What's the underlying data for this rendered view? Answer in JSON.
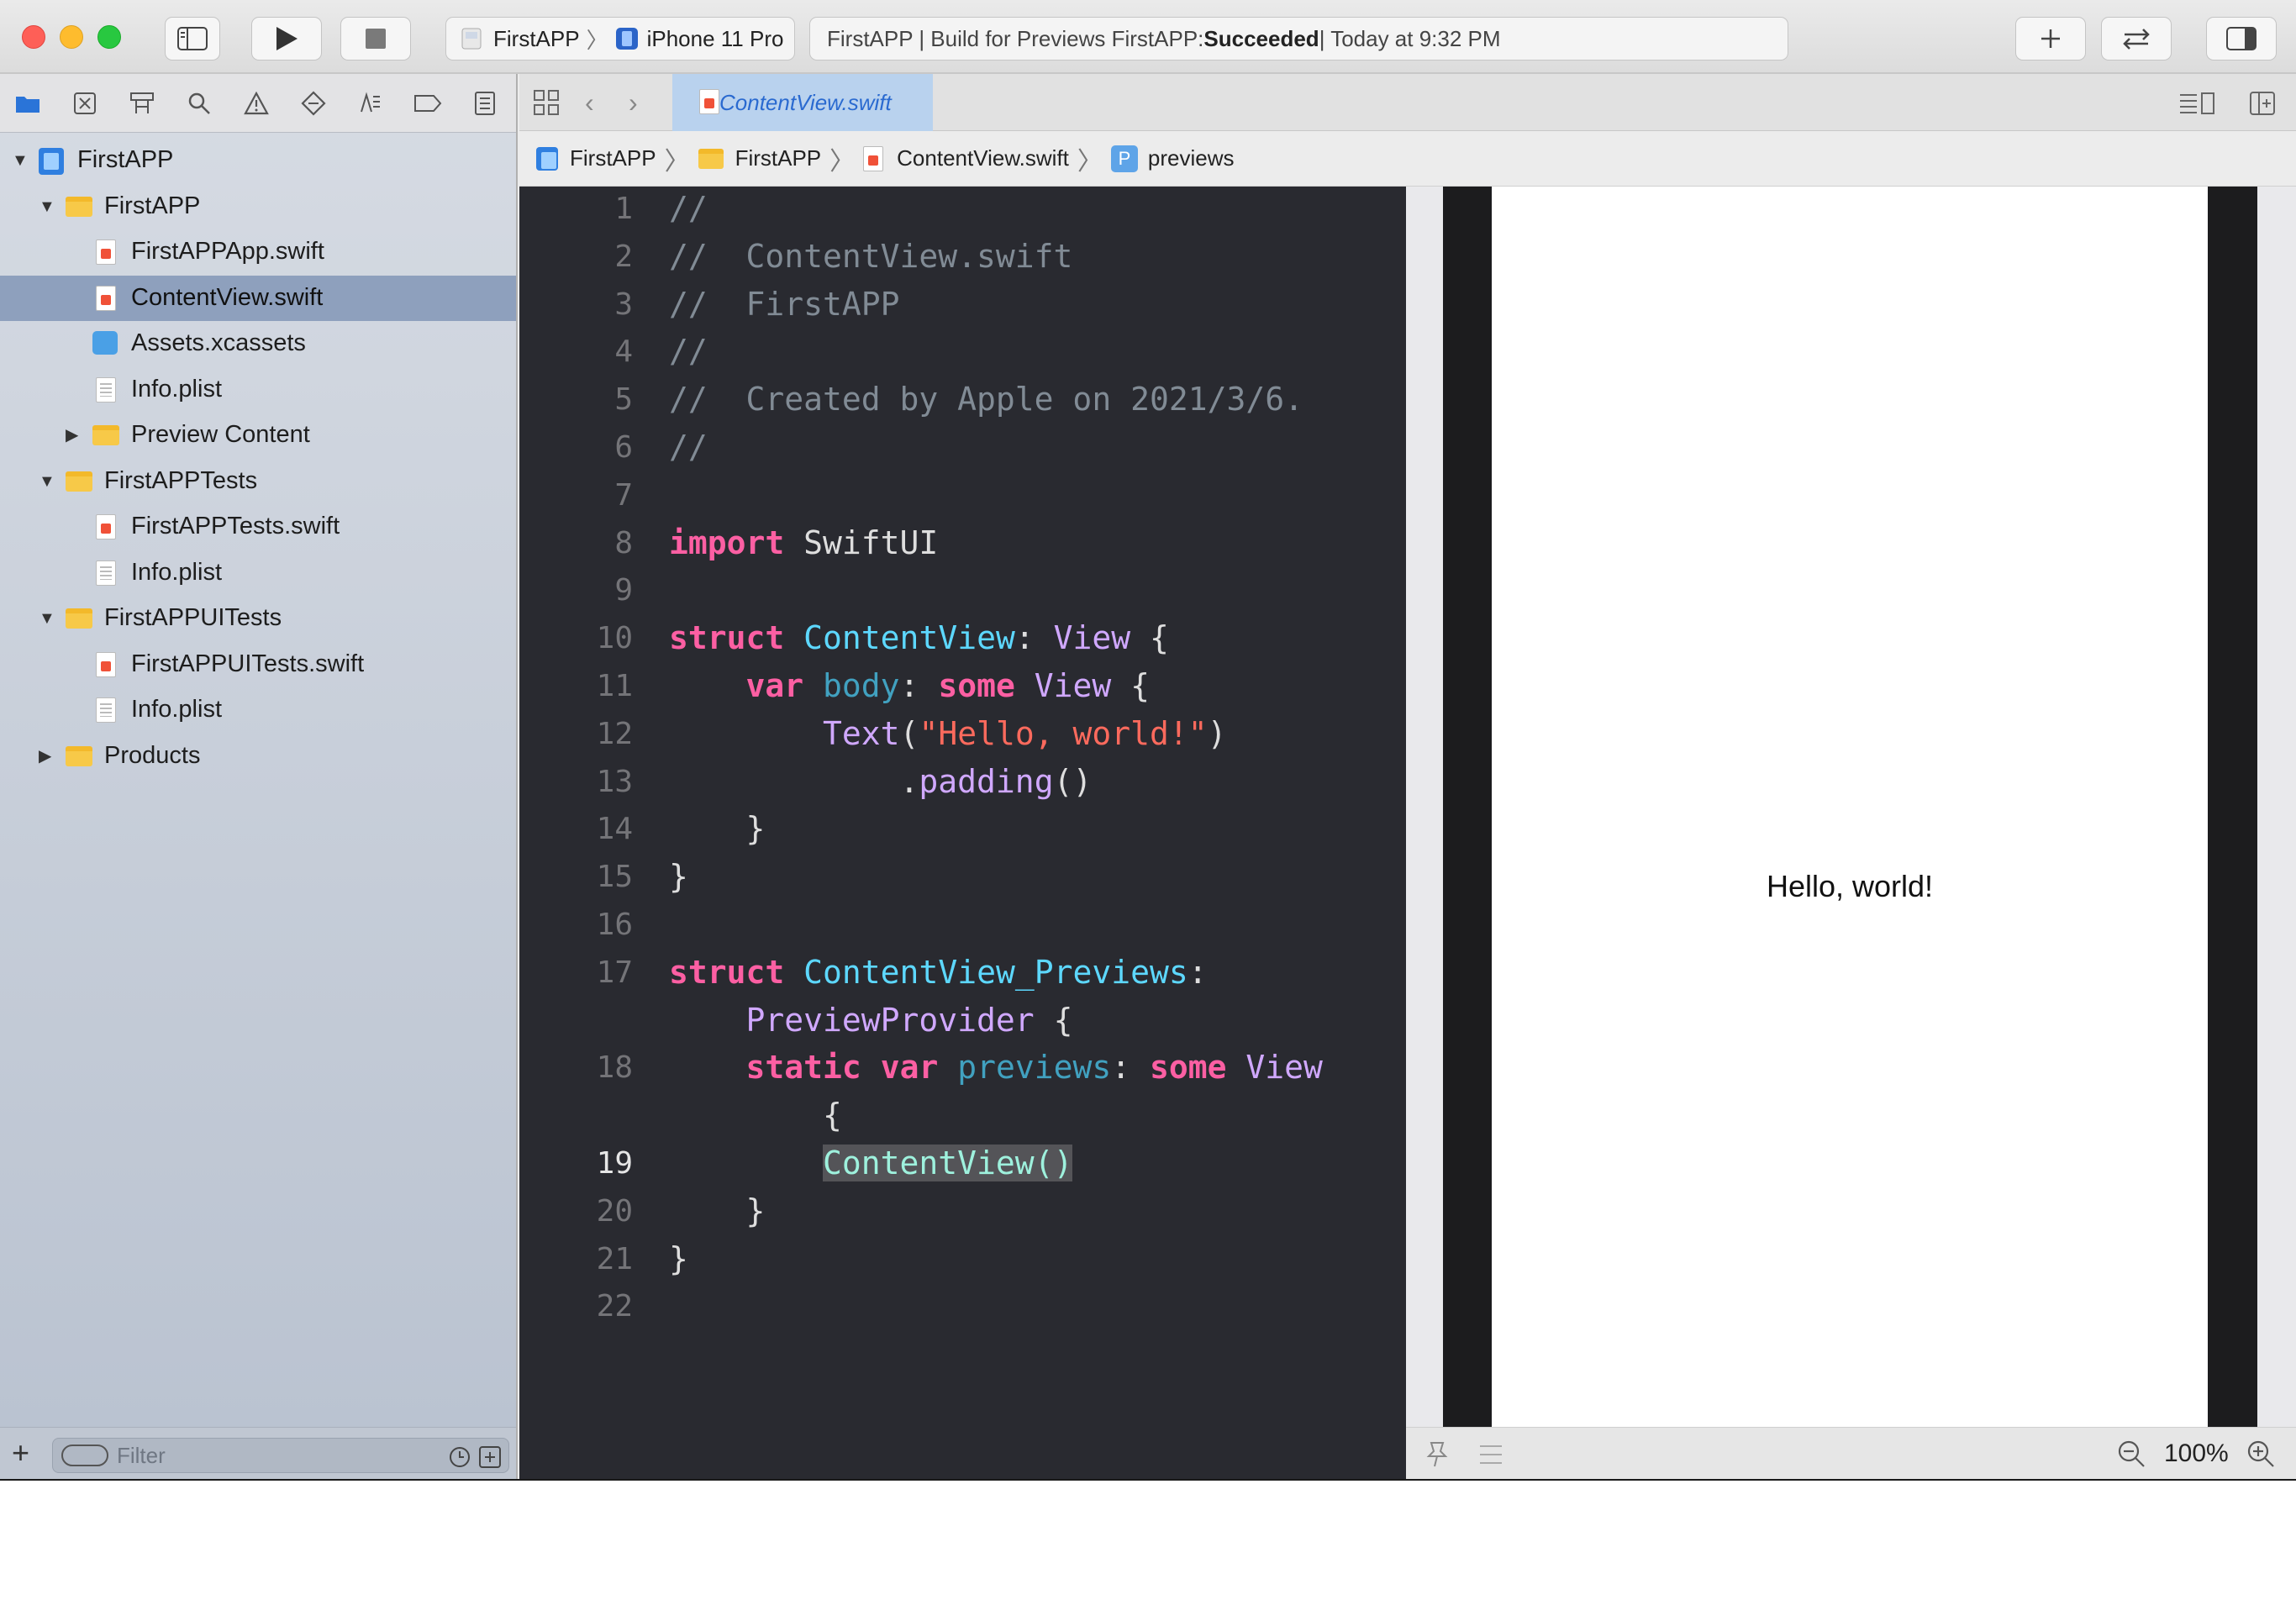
{
  "toolbar": {
    "scheme_project": "FirstAPP",
    "scheme_device": "iPhone 11 Pro",
    "status_prefix": "FirstAPP | Build for Previews FirstAPP: ",
    "status_result": "Succeeded",
    "status_suffix": " | Today at 9:32 PM"
  },
  "navigator": {
    "tree": [
      {
        "label": "FirstAPP",
        "kind": "project",
        "level": 0,
        "expanded": true
      },
      {
        "label": "FirstAPP",
        "kind": "folder",
        "level": 1,
        "expanded": true
      },
      {
        "label": "FirstAPPApp.swift",
        "kind": "swift",
        "level": 2
      },
      {
        "label": "ContentView.swift",
        "kind": "swift",
        "level": 2,
        "selected": true
      },
      {
        "label": "Assets.xcassets",
        "kind": "assets",
        "level": 2
      },
      {
        "label": "Info.plist",
        "kind": "plist",
        "level": 2
      },
      {
        "label": "Preview Content",
        "kind": "folder",
        "level": 2,
        "expanded": false
      },
      {
        "label": "FirstAPPTests",
        "kind": "folder",
        "level": 1,
        "expanded": true
      },
      {
        "label": "FirstAPPTests.swift",
        "kind": "swift",
        "level": 2
      },
      {
        "label": "Info.plist",
        "kind": "plist",
        "level": 2
      },
      {
        "label": "FirstAPPUITests",
        "kind": "folder",
        "level": 1,
        "expanded": true
      },
      {
        "label": "FirstAPPUITests.swift",
        "kind": "swift",
        "level": 2
      },
      {
        "label": "Info.plist",
        "kind": "plist",
        "level": 2
      },
      {
        "label": "Products",
        "kind": "folder",
        "level": 1,
        "expanded": false
      }
    ],
    "filter_placeholder": "Filter"
  },
  "editor": {
    "tab_title": "ContentView.swift",
    "jumpbar": [
      "FirstAPP",
      "FirstAPP",
      "ContentView.swift",
      "previews"
    ],
    "current_line": "19"
  },
  "canvas": {
    "preview_text": "Hello, world!",
    "zoom": "100%"
  }
}
